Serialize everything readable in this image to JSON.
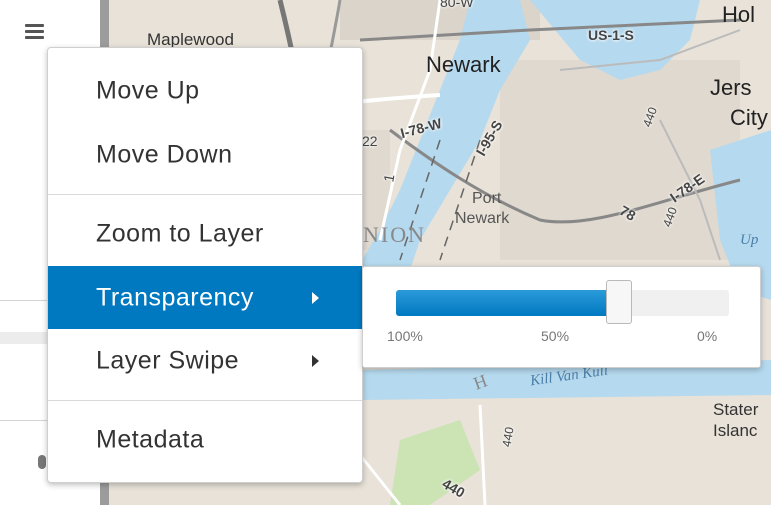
{
  "map": {
    "labels": {
      "maplewood": "Maplewood",
      "newark": "Newark",
      "jersey_city_1": "Jers",
      "jersey_city_2": "City",
      "hoboken": "Hol",
      "port_newark_1": "Port",
      "port_newark_2": "Newark",
      "union": "NION",
      "staten_1": "Stater",
      "staten_2": "Islanc",
      "upper_bay": "Up",
      "kill_van_kull": "Kill Van Kull",
      "h_letter": "H"
    },
    "highways": {
      "us1": "US-1-S",
      "i78w": "I-78-W",
      "i95s": "I-95-S",
      "i78e": "I-78-E",
      "i440_a": "440",
      "i440_b": "440",
      "i440_c": "440",
      "i440_d": "440",
      "i22": "22",
      "r78": "78",
      "r1": "1",
      "top_partial": "80-W"
    }
  },
  "menu": {
    "items": [
      {
        "label": "Move Up"
      },
      {
        "label": "Move Down"
      },
      {
        "label": "Zoom to Layer"
      },
      {
        "label": "Transparency",
        "active": true,
        "submenu": true
      },
      {
        "label": "Layer Swipe",
        "submenu": true
      },
      {
        "label": "Metadata"
      }
    ]
  },
  "transparency": {
    "value_percent": 67,
    "ticks": [
      "100%",
      "50%",
      "0%"
    ]
  },
  "colors": {
    "accent": "#0079c1",
    "water": "#b5d9ee",
    "park": "#c9e3b0"
  }
}
